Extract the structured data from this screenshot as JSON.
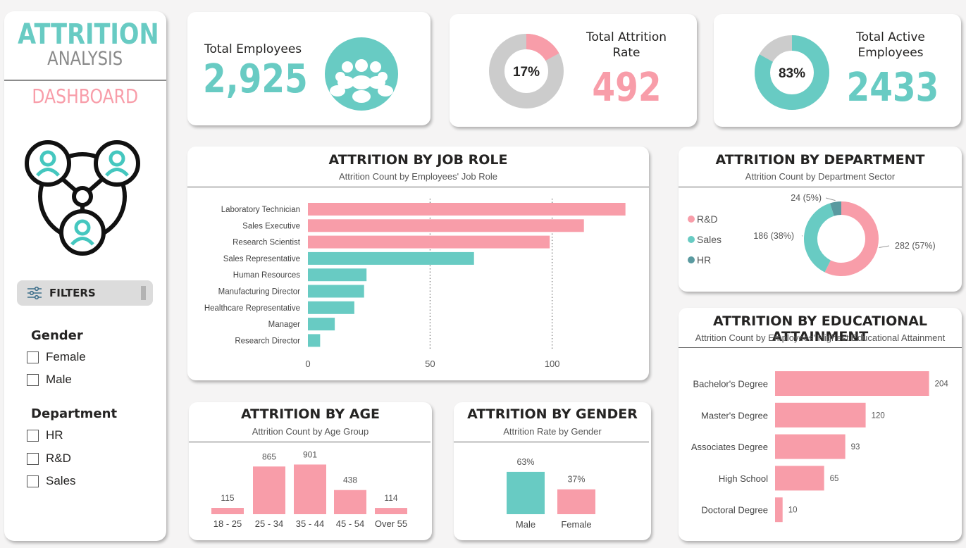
{
  "sidebar": {
    "title_line1": "ATTRITION",
    "title_line2": "ANALYSIS",
    "title_line3": "DASHBOARD",
    "filters_label": "FILTERS",
    "gender": {
      "heading": "Gender",
      "options": [
        "Female",
        "Male"
      ]
    },
    "department": {
      "heading": "Department",
      "options": [
        "HR",
        "R&D",
        "Sales"
      ]
    }
  },
  "kpis": {
    "total_employees": {
      "label": "Total Employees",
      "value": "2,925"
    },
    "attrition_rate": {
      "label_line1": "Total Attrition",
      "label_line2": "Rate",
      "value": "492",
      "donut_label": "17%",
      "percent": 17
    },
    "active": {
      "label_line1": "Total Active",
      "label_line2": "Employees",
      "value": "2433",
      "donut_label": "83%",
      "percent": 83
    }
  },
  "colors": {
    "teal": "#68cbc3",
    "pink": "#f89da9",
    "dark_teal": "#5a9aa0",
    "grey": "#cccccc"
  },
  "job_role": {
    "title": "ATTRITION BY JOB ROLE",
    "subtitle": "Attrition Count by Employees' Job Role"
  },
  "department_chart": {
    "title": "ATTRITION BY DEPARTMENT",
    "subtitle": "Attrition Count by Department Sector"
  },
  "education": {
    "title": "ATTRITION BY EDUCATIONAL ATTAINMENT",
    "subtitle": "Attrition Count by Employees' Highest Educational Attainment"
  },
  "age": {
    "title": "ATTRITION BY AGE",
    "subtitle": "Attrition Count by Age Group"
  },
  "gender_chart": {
    "title": "ATTRITION BY GENDER",
    "subtitle": "Attrition Rate by Gender"
  },
  "chart_data": [
    {
      "id": "job_role",
      "type": "bar",
      "orientation": "horizontal",
      "categories": [
        "Laboratory Technician",
        "Sales Executive",
        "Research Scientist",
        "Sales Representative",
        "Human Resources",
        "Manufacturing Director",
        "Healthcare Representative",
        "Manager",
        "Research Director"
      ],
      "values": [
        130,
        113,
        99,
        68,
        24,
        23,
        19,
        11,
        5
      ],
      "colors": [
        "#f89da9",
        "#f89da9",
        "#f89da9",
        "#68cbc3",
        "#68cbc3",
        "#68cbc3",
        "#68cbc3",
        "#68cbc3",
        "#68cbc3"
      ],
      "xticks": [
        0,
        50,
        100
      ],
      "xlim": [
        0,
        135
      ],
      "grid": "vertical dotted"
    },
    {
      "id": "department",
      "type": "pie",
      "donut": true,
      "labels": [
        "R&D",
        "Sales",
        "HR"
      ],
      "values": [
        282,
        186,
        24
      ],
      "data_labels": [
        "282 (57%)",
        "186 (38%)",
        "24 (5%)"
      ],
      "colors": [
        "#f89da9",
        "#68cbc3",
        "#5a9aa0"
      ],
      "legend": "left"
    },
    {
      "id": "education",
      "type": "bar",
      "orientation": "horizontal",
      "categories": [
        "Bachelor's Degree",
        "Master's Degree",
        "Associates Degree",
        "High School",
        "Doctoral Degree"
      ],
      "values": [
        204,
        120,
        93,
        65,
        10
      ],
      "data_labels": [
        "204",
        "120",
        "93",
        "65",
        "10"
      ],
      "color": "#f89da9",
      "xlim": [
        0,
        210
      ]
    },
    {
      "id": "age",
      "type": "bar",
      "categories": [
        "18 - 25",
        "25 - 34",
        "35 - 44",
        "45 - 54",
        "Over 55"
      ],
      "values": [
        115,
        865,
        901,
        438,
        114
      ],
      "data_labels": [
        "115",
        "865",
        "901",
        "438",
        "114"
      ],
      "color": "#f89da9",
      "ylim": [
        0,
        920
      ]
    },
    {
      "id": "gender",
      "type": "bar",
      "categories": [
        "Male",
        "Female"
      ],
      "values": [
        63,
        37
      ],
      "data_labels": [
        "63%",
        "37%"
      ],
      "colors": [
        "#68cbc3",
        "#f89da9"
      ],
      "ylim": [
        0,
        65
      ]
    }
  ]
}
